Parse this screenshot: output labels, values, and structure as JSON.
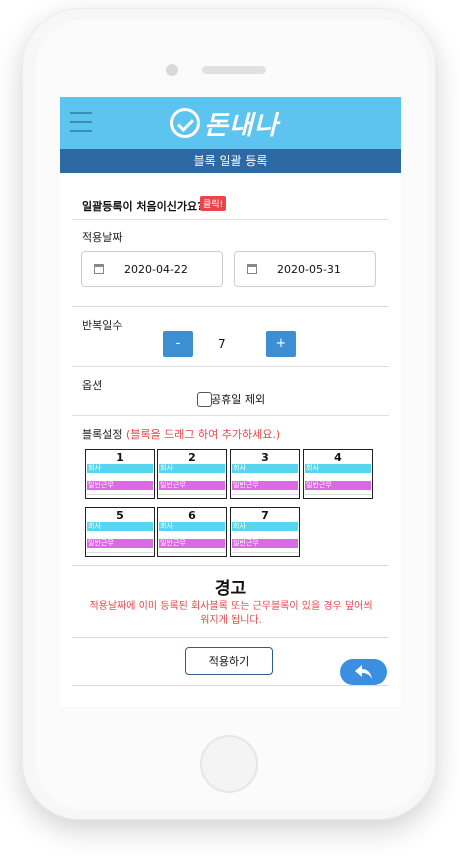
{
  "header": {
    "logo_text": "돈내나",
    "subtitle": "블록 일괄 등록"
  },
  "intro": {
    "question": "일괄등록이 처음이신가요?",
    "click_badge": "클릭!"
  },
  "date_section": {
    "label": "적용날짜",
    "start_date": "2020-04-22",
    "end_date": "2020-05-31"
  },
  "repeat_section": {
    "label": "반복일수",
    "minus": "-",
    "value": "7",
    "plus": "+"
  },
  "options": {
    "label": "옵션",
    "exclude_holidays_label": "공휴일 제외",
    "exclude_holidays_checked": false
  },
  "blocks_section": {
    "label": "블록설정",
    "hint": "(블록을 드래그 하여 추가하세요.)",
    "blocks": [
      {
        "num": "1",
        "company": "회사",
        "work": "일반근무"
      },
      {
        "num": "2",
        "company": "회사",
        "work": "일반근무"
      },
      {
        "num": "3",
        "company": "회사",
        "work": "일반근무"
      },
      {
        "num": "4",
        "company": "회사",
        "work": "일반근무"
      },
      {
        "num": "5",
        "company": "회사",
        "work": "일반근무"
      },
      {
        "num": "6",
        "company": "회사",
        "work": "일반근무"
      },
      {
        "num": "7",
        "company": "회사",
        "work": "일반근무"
      }
    ]
  },
  "warning": {
    "title": "경고",
    "text_line1": "적용날짜에 이미 등록된 회사블록 또는 근무블록이 있을 경우 덮어씌",
    "text_line2": "워지게 됩니다."
  },
  "apply_button": "적용하기",
  "icons": {
    "menu": "hamburger-icon",
    "calendar": "calendar-icon",
    "back": "back-arrow-icon",
    "logo": "check-circle-logo-icon"
  },
  "colors": {
    "header": "#5cc4ef",
    "subbar": "#2d6aa3",
    "accent_blue": "#3d8fd4",
    "warning_red": "#e8464b",
    "company_block": "#55d6ee",
    "work_block": "#d96ae3"
  }
}
